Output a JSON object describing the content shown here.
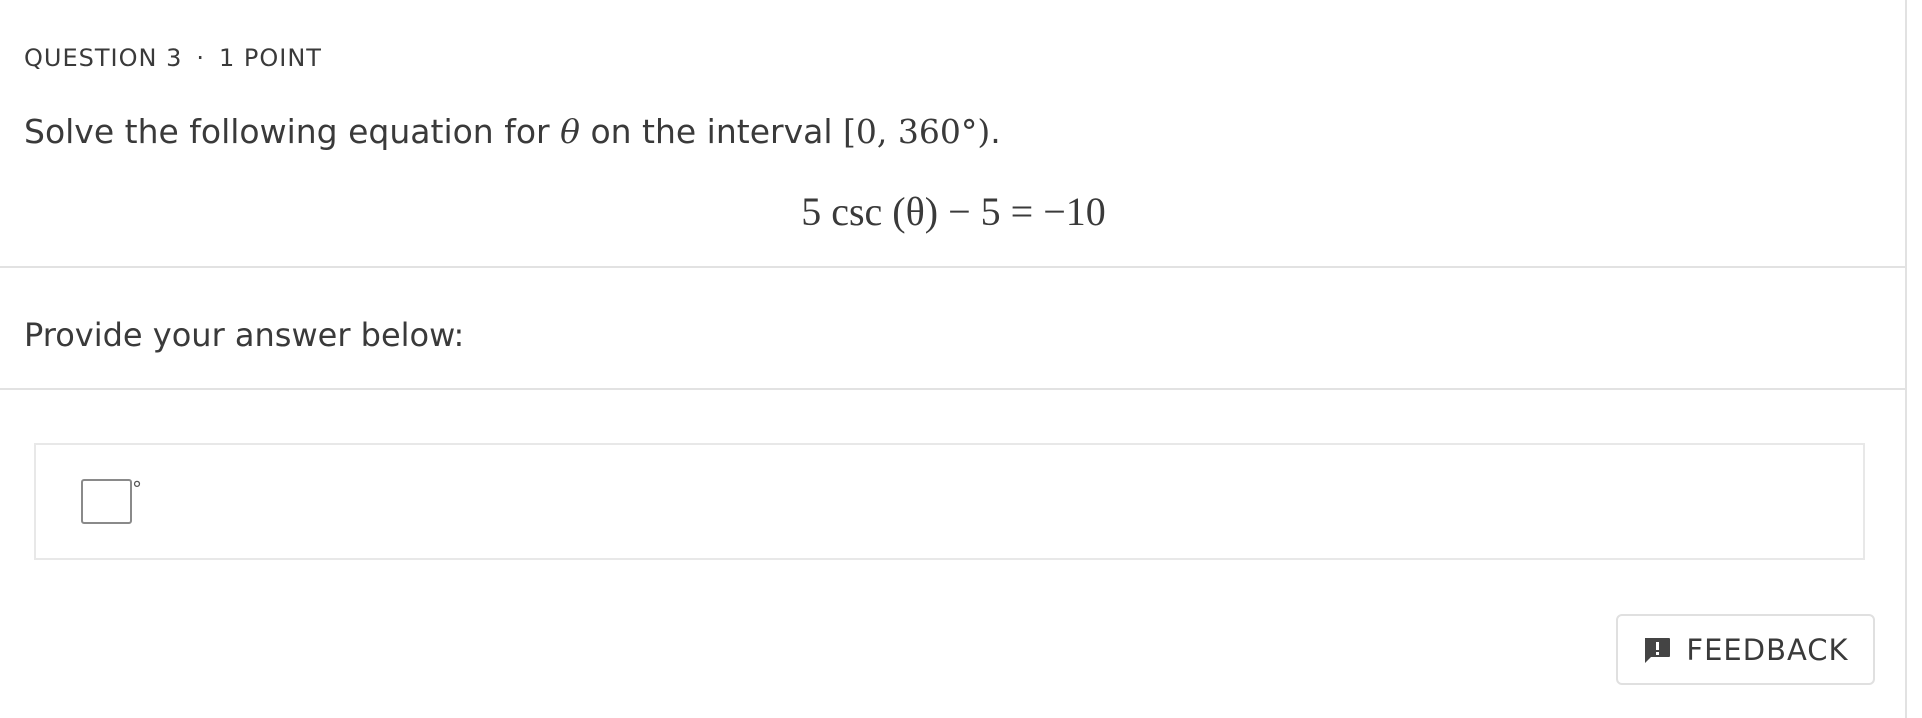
{
  "question": {
    "number_label": "QUESTION 3",
    "separator": "·",
    "points_label": "1 POINT"
  },
  "prompt": {
    "text_before": "Solve the following equation for ",
    "variable": "θ",
    "text_middle": " on the interval ",
    "interval": "[0, 360°)",
    "text_after": "."
  },
  "equation": "5 csc (θ) − 5 = −10",
  "answer": {
    "label": "Provide your answer below:",
    "value": "",
    "unit_symbol": "°"
  },
  "feedback": {
    "label": "FEEDBACK",
    "icon": "feedback-icon"
  },
  "colors": {
    "text": "#3a3a3a",
    "divider": "#e2e2e2",
    "icon": "#444444"
  }
}
